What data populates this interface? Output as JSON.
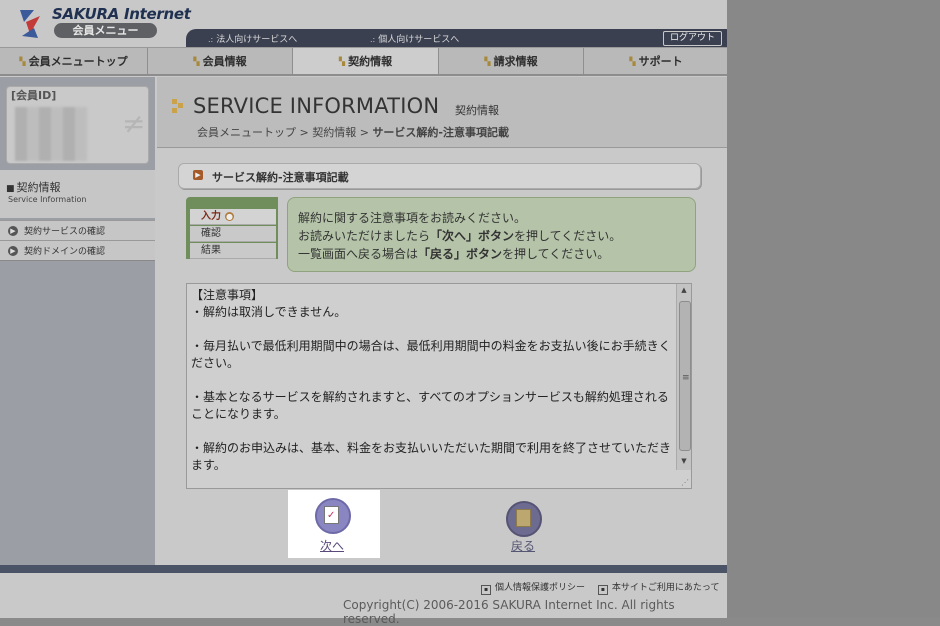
{
  "header": {
    "logo_name": "SAKURA Internet",
    "logo_sub": "会員メニュー",
    "link_corporate": "法人向けサービスへ",
    "link_personal": "個人向けサービスへ",
    "logout": "ログアウト"
  },
  "nav": {
    "items": [
      "会員メニュートップ",
      "会員情報",
      "契約情報",
      "請求情報",
      "サポート"
    ],
    "active": "契約情報"
  },
  "sidebar": {
    "member_id_label": "[会員ID]",
    "section_title": "契約情報",
    "section_sub": "Service Information",
    "links": [
      "契約サービスの確認",
      "契約ドメインの確認"
    ]
  },
  "main": {
    "title": "SERVICE INFORMATION",
    "subtitle": "契約情報",
    "breadcrumb": {
      "item1": "会員メニュートップ",
      "sep": ">",
      "item2": "契約情報",
      "current": "サービス解約-注意事項記載"
    },
    "section_title": "サービス解約-注意事項記載",
    "steps": [
      "入力",
      "確認",
      "結果"
    ],
    "info": {
      "line1": "解約に関する注意事項をお読みください。",
      "line2_pre": "お読みいただけましたら",
      "line2_bold": "「次へ」ボタン",
      "line2_post": "を押してください。",
      "line3_pre": "一覧画面へ戻る場合は",
      "line3_bold": "「戻る」ボタン",
      "line3_post": "を押してください。"
    },
    "notice_text": "【注意事項】\n・解約は取消しできません。\n\n・毎月払いで最低利用期間中の場合は、最低利用期間中の料金をお支払い後にお手続きください。\n\n・基本となるサービスを解約されますと、すべてのオプションサービスも解約処理されることになります。\n\n・解約のお申込みは、基本、料金をお支払いいただいた期間で利用を終了させていただきます。",
    "next_label": "次へ",
    "back_label": "戻る"
  },
  "footer": {
    "privacy": "個人情報保護ポリシー",
    "terms": "本サイトご利用にあたって",
    "copyright": "Copyright(C) 2006-2016 SAKURA Internet Inc. All rights reserved."
  }
}
